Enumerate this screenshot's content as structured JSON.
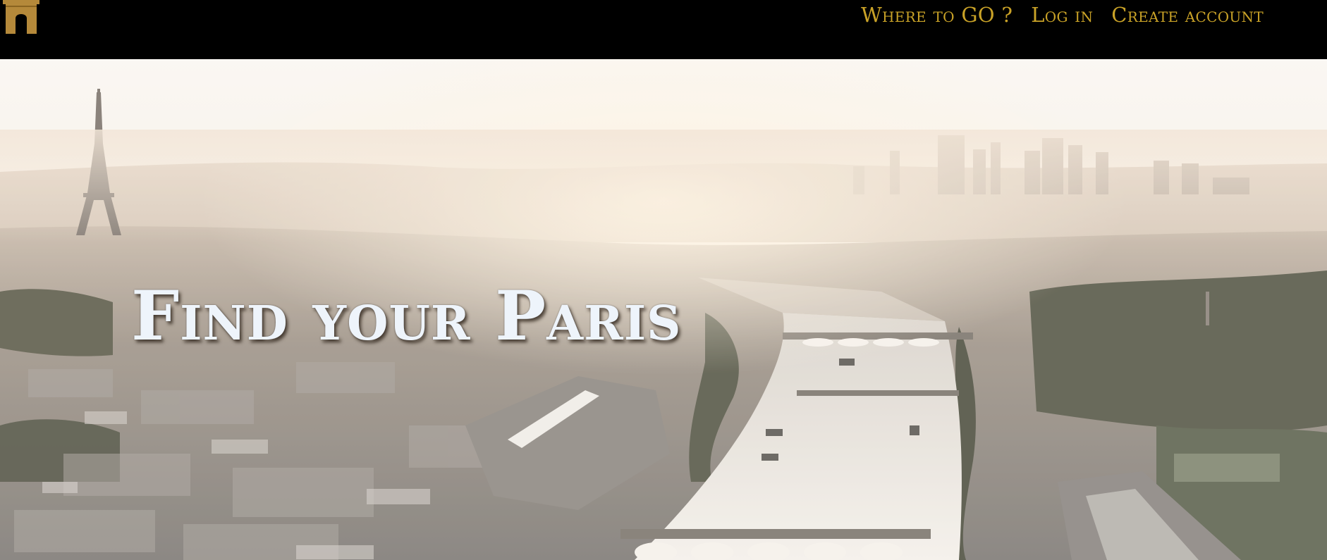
{
  "header": {
    "logo_icon": "arch-icon",
    "nav": {
      "where_to_go": "Where to GO ?",
      "log_in": "Log in",
      "create_account": "Create account"
    }
  },
  "hero": {
    "title": "Find your Paris",
    "background": "aerial-paris-seine-sunset"
  },
  "colors": {
    "topbar_bg": "#000000",
    "nav_text": "#c9a227",
    "logo": "#b5893a",
    "hero_title": "#eef4fb"
  }
}
